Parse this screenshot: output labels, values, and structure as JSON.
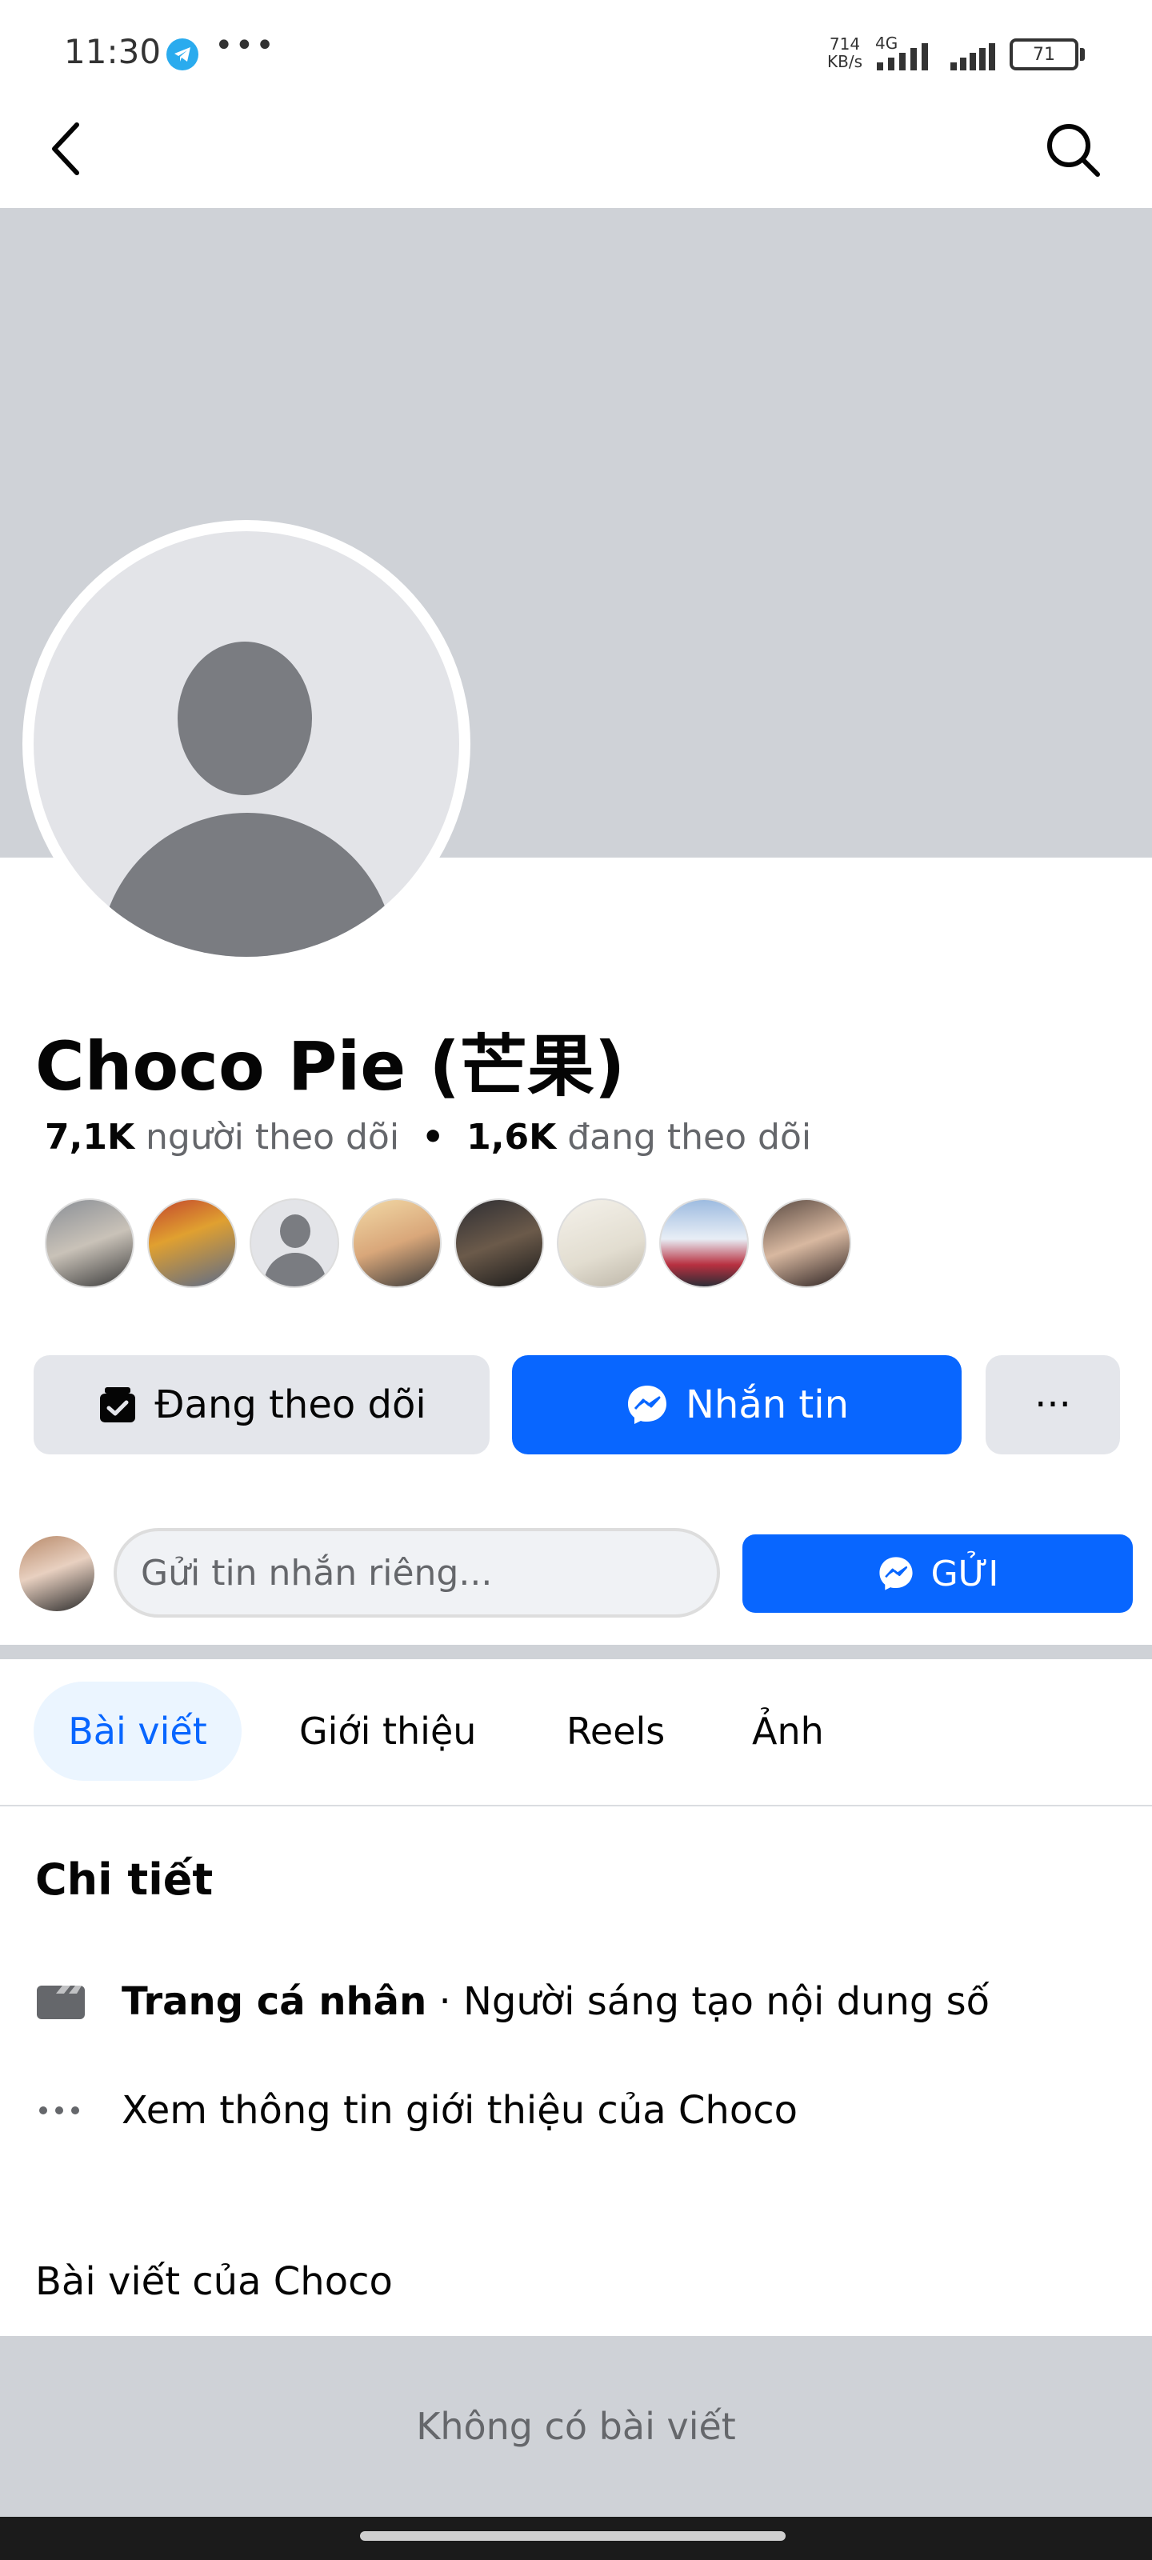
{
  "status_bar": {
    "time": "11:30",
    "dots": "•••",
    "net_speed_value": "714",
    "net_speed_unit": "KB/s",
    "network": "4G",
    "battery": "71"
  },
  "top_nav": {
    "back_icon": "chevron-left-icon",
    "search_icon": "search-icon"
  },
  "profile": {
    "name": "Choco Pie (芒果)",
    "followers_count": "7,1K",
    "followers_label": "người theo dõi",
    "separator": "•",
    "following_count": "1,6K",
    "following_label": "đang theo dõi"
  },
  "friends_count": 8,
  "actions": {
    "follow_label": "Đang theo dõi",
    "message_label": "Nhắn tin",
    "more_label": "···"
  },
  "private_message": {
    "placeholder": "Gửi tin nhắn riêng...",
    "send_label": "GỬI"
  },
  "tabs": [
    {
      "label": "Bài viết",
      "active": true
    },
    {
      "label": "Giới thiệu",
      "active": false
    },
    {
      "label": "Reels",
      "active": false
    },
    {
      "label": "Ảnh",
      "active": false
    }
  ],
  "details": {
    "title": "Chi tiết",
    "page_type_bold": "Trang cá nhân",
    "page_type_rest": " · Người sáng tạo nội dung số",
    "see_about": "Xem thông tin giới thiệu của Choco"
  },
  "posts": {
    "title": "Bài viết của Choco",
    "empty": "Không có bài viết"
  },
  "colors": {
    "accent": "#0866ff",
    "cover": "#cfd2d7",
    "button_gray": "#e4e6eb",
    "active_tab_bg": "#ebf5ff"
  }
}
